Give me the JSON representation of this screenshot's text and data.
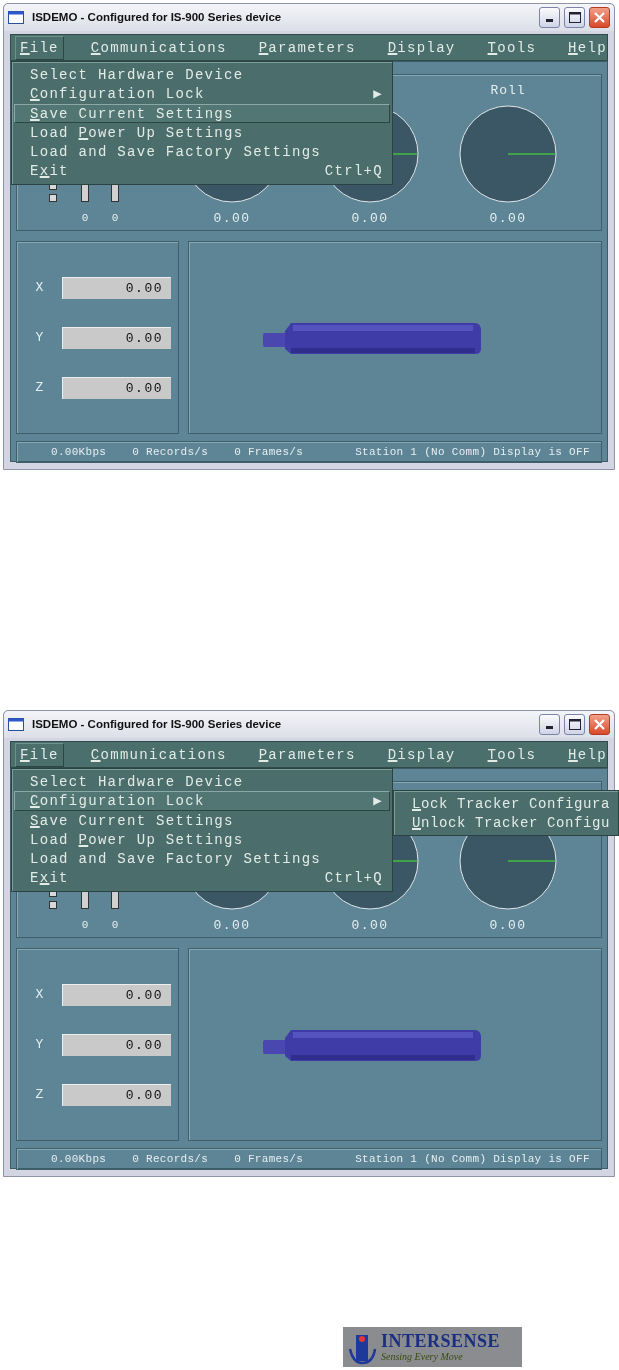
{
  "screenshots": [
    {
      "window": {
        "title": "ISDEMO - Configured for IS-900 Series device"
      },
      "menu_bar": [
        {
          "parts": [
            {
              "text": "F",
              "underlined": true
            },
            {
              "text": "ile",
              "underlined": false
            }
          ],
          "selected": true
        },
        {
          "parts": [
            {
              "text": "C",
              "underlined": true
            },
            {
              "text": "ommunications",
              "underlined": false
            }
          ],
          "selected": false
        },
        {
          "parts": [
            {
              "text": "P",
              "underlined": true
            },
            {
              "text": "arameters",
              "underlined": false
            }
          ],
          "selected": false
        },
        {
          "parts": [
            {
              "text": "D",
              "underlined": true
            },
            {
              "text": "isplay",
              "underlined": false
            }
          ],
          "selected": false
        },
        {
          "parts": [
            {
              "text": "T",
              "underlined": true
            },
            {
              "text": "ools",
              "underlined": false
            }
          ],
          "selected": false
        },
        {
          "parts": [
            {
              "text": "H",
              "underlined": true
            },
            {
              "text": "elp",
              "underlined": false
            }
          ],
          "selected": false
        }
      ],
      "file_menu": [
        {
          "parts": [
            {
              "text": "Select Hardware Device",
              "underlined": false
            }
          ],
          "selected": false
        },
        {
          "parts": [
            {
              "text": "C",
              "underlined": true
            },
            {
              "text": "onfiguration Lock",
              "underlined": false
            }
          ],
          "arrow": "▶",
          "selected": false
        },
        {
          "parts": [
            {
              "text": "S",
              "underlined": true
            },
            {
              "text": "ave Current Settings",
              "underlined": false
            }
          ],
          "selected": true
        },
        {
          "parts": [
            {
              "text": "Load ",
              "underlined": false
            },
            {
              "text": "P",
              "underlined": true
            },
            {
              "text": "ower Up Settings",
              "underlined": false
            }
          ],
          "selected": false
        },
        {
          "parts": [
            {
              "text": "Load and Save Factory Settings",
              "underlined": false
            }
          ],
          "selected": false
        },
        {
          "parts": [
            {
              "text": "E",
              "underlined": false
            },
            {
              "text": "x",
              "underlined": true
            },
            {
              "text": "it",
              "underlined": false
            }
          ],
          "shortcut": "Ctrl+Q",
          "selected": false
        }
      ],
      "gauges": {
        "bars": [
          {
            "value": "0"
          },
          {
            "value": "0"
          }
        ],
        "dials": [
          {
            "reading": "0.00"
          },
          {
            "reading": "0.00"
          },
          {
            "label": "Roll",
            "reading": "0.00"
          }
        ]
      },
      "position": [
        {
          "axis": "X",
          "value": "0.00"
        },
        {
          "axis": "Y",
          "value": "0.00"
        },
        {
          "axis": "Z",
          "value": "0.00"
        }
      ],
      "status_bar": [
        "0.00Kbps",
        "0 Records/s",
        "0 Frames/s",
        "Station 1 (No Comm) Display is OFF"
      ]
    },
    {
      "window": {
        "title": "ISDEMO - Configured for IS-900 Series device"
      },
      "menu_bar": [
        {
          "parts": [
            {
              "text": "F",
              "underlined": true
            },
            {
              "text": "ile",
              "underlined": false
            }
          ],
          "selected": true
        },
        {
          "parts": [
            {
              "text": "C",
              "underlined": true
            },
            {
              "text": "ommunications",
              "underlined": false
            }
          ],
          "selected": false
        },
        {
          "parts": [
            {
              "text": "P",
              "underlined": true
            },
            {
              "text": "arameters",
              "underlined": false
            }
          ],
          "selected": false
        },
        {
          "parts": [
            {
              "text": "D",
              "underlined": true
            },
            {
              "text": "isplay",
              "underlined": false
            }
          ],
          "selected": false
        },
        {
          "parts": [
            {
              "text": "T",
              "underlined": true
            },
            {
              "text": "ools",
              "underlined": false
            }
          ],
          "selected": false
        },
        {
          "parts": [
            {
              "text": "H",
              "underlined": true
            },
            {
              "text": "elp",
              "underlined": false
            }
          ],
          "selected": false
        }
      ],
      "file_menu": [
        {
          "parts": [
            {
              "text": "Select Hardware Device",
              "underlined": false
            }
          ],
          "selected": false
        },
        {
          "parts": [
            {
              "text": "C",
              "underlined": true
            },
            {
              "text": "onfiguration Lock",
              "underlined": false
            }
          ],
          "arrow": "▶",
          "selected": true
        },
        {
          "parts": [
            {
              "text": "S",
              "underlined": true
            },
            {
              "text": "ave Current Settings",
              "underlined": false
            }
          ],
          "selected": false
        },
        {
          "parts": [
            {
              "text": "Load ",
              "underlined": false
            },
            {
              "text": "P",
              "underlined": true
            },
            {
              "text": "ower Up Settings",
              "underlined": false
            }
          ],
          "selected": false
        },
        {
          "parts": [
            {
              "text": "Load and Save Factory Settings",
              "underlined": false
            }
          ],
          "selected": false
        },
        {
          "parts": [
            {
              "text": "E",
              "underlined": false
            },
            {
              "text": "x",
              "underlined": true
            },
            {
              "text": "it",
              "underlined": false
            }
          ],
          "shortcut": "Ctrl+Q",
          "selected": false
        }
      ],
      "submenu": [
        {
          "parts": [
            {
              "text": "L",
              "underlined": true
            },
            {
              "text": "ock Tracker Configura",
              "underlined": false
            }
          ],
          "selected": false
        },
        {
          "parts": [
            {
              "text": "U",
              "underlined": true
            },
            {
              "text": "nlock Tracker Configu",
              "underlined": false
            }
          ],
          "selected": false
        }
      ],
      "gauges": {
        "bars": [
          {
            "value": "0"
          },
          {
            "value": "0"
          }
        ],
        "dials": [
          {
            "reading": "0.00"
          },
          {
            "reading": "0.00"
          },
          {
            "reading": "0.00"
          }
        ]
      },
      "position": [
        {
          "axis": "X",
          "value": "0.00"
        },
        {
          "axis": "Y",
          "value": "0.00"
        },
        {
          "axis": "Z",
          "value": "0.00"
        }
      ],
      "status_bar": [
        "0.00Kbps",
        "0 Records/s",
        "0 Frames/s",
        "Station 1 (No Comm) Display is OFF"
      ]
    }
  ],
  "logo": {
    "wordmark": "INTERSENSE",
    "tagline": "Sensing Every Move"
  }
}
